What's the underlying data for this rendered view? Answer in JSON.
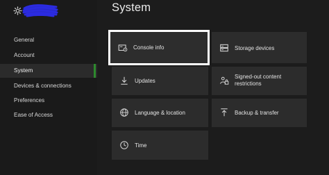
{
  "header": {
    "title": "System"
  },
  "sidebar": {
    "items": [
      {
        "label": "General"
      },
      {
        "label": "Account"
      },
      {
        "label": "System"
      },
      {
        "label": "Devices & connections"
      },
      {
        "label": "Preferences"
      },
      {
        "label": "Ease of Access"
      }
    ],
    "selected": "System"
  },
  "tiles": [
    {
      "label": "Console info",
      "icon": "console-info-icon"
    },
    {
      "label": "Storage devices",
      "icon": "storage-icon"
    },
    {
      "label": "Updates",
      "icon": "download-icon"
    },
    {
      "label": "Signed-out content restrictions",
      "icon": "people-lock-icon"
    },
    {
      "label": "Language & location",
      "icon": "globe-icon"
    },
    {
      "label": "Backup & transfer",
      "icon": "upload-icon"
    },
    {
      "label": "Time",
      "icon": "clock-icon"
    }
  ],
  "colors": {
    "background": "#1c1c1c",
    "tile": "#2c2c2c",
    "accent": "#2d8a2d",
    "focus": "#ffffff",
    "scribble": "#2b2be0"
  }
}
